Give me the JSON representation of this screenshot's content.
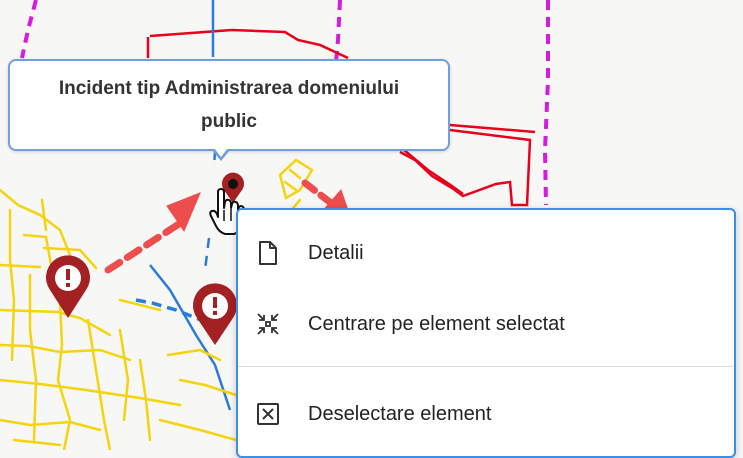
{
  "map": {
    "tooltip_text": "Incident tip Administrarea domeniului public",
    "incident_marker_icon": "exclamation-pin-icon",
    "selected_marker_icon": "location-pin-icon",
    "road_color": "#f5d30f",
    "parcel_color": "#e8001c",
    "boundary_color": "#d61adf",
    "water_color": "#2b7bd8",
    "marker_color": "#a32023",
    "arrow_color": "#ee4d4d"
  },
  "context_menu": {
    "items": [
      {
        "label": "Detalii",
        "icon": "document-icon"
      },
      {
        "label": "Centrare pe element selectat",
        "icon": "center-focus-icon"
      },
      {
        "label": "Deselectare element",
        "icon": "deselect-box-icon"
      }
    ]
  }
}
